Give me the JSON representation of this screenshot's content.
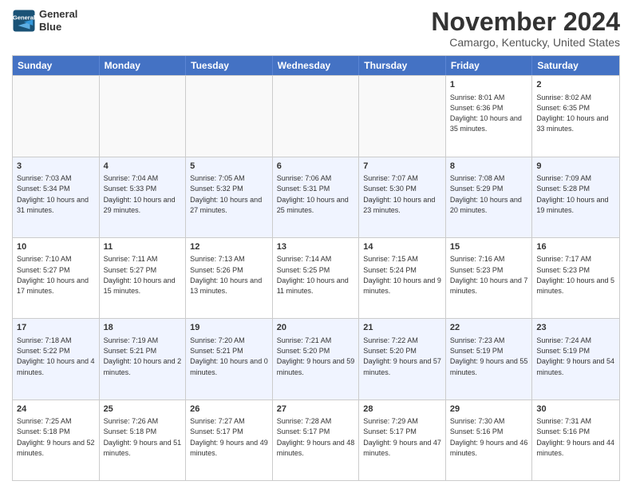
{
  "logo": {
    "line1": "General",
    "line2": "Blue"
  },
  "title": "November 2024",
  "location": "Camargo, Kentucky, United States",
  "days_of_week": [
    "Sunday",
    "Monday",
    "Tuesday",
    "Wednesday",
    "Thursday",
    "Friday",
    "Saturday"
  ],
  "weeks": [
    [
      {
        "day": "",
        "sunrise": "",
        "sunset": "",
        "daylight": "",
        "empty": true
      },
      {
        "day": "",
        "sunrise": "",
        "sunset": "",
        "daylight": "",
        "empty": true
      },
      {
        "day": "",
        "sunrise": "",
        "sunset": "",
        "daylight": "",
        "empty": true
      },
      {
        "day": "",
        "sunrise": "",
        "sunset": "",
        "daylight": "",
        "empty": true
      },
      {
        "day": "",
        "sunrise": "",
        "sunset": "",
        "daylight": "",
        "empty": true
      },
      {
        "day": "1",
        "sunrise": "Sunrise: 8:01 AM",
        "sunset": "Sunset: 6:36 PM",
        "daylight": "Daylight: 10 hours and 35 minutes.",
        "empty": false
      },
      {
        "day": "2",
        "sunrise": "Sunrise: 8:02 AM",
        "sunset": "Sunset: 6:35 PM",
        "daylight": "Daylight: 10 hours and 33 minutes.",
        "empty": false
      }
    ],
    [
      {
        "day": "3",
        "sunrise": "Sunrise: 7:03 AM",
        "sunset": "Sunset: 5:34 PM",
        "daylight": "Daylight: 10 hours and 31 minutes.",
        "empty": false
      },
      {
        "day": "4",
        "sunrise": "Sunrise: 7:04 AM",
        "sunset": "Sunset: 5:33 PM",
        "daylight": "Daylight: 10 hours and 29 minutes.",
        "empty": false
      },
      {
        "day": "5",
        "sunrise": "Sunrise: 7:05 AM",
        "sunset": "Sunset: 5:32 PM",
        "daylight": "Daylight: 10 hours and 27 minutes.",
        "empty": false
      },
      {
        "day": "6",
        "sunrise": "Sunrise: 7:06 AM",
        "sunset": "Sunset: 5:31 PM",
        "daylight": "Daylight: 10 hours and 25 minutes.",
        "empty": false
      },
      {
        "day": "7",
        "sunrise": "Sunrise: 7:07 AM",
        "sunset": "Sunset: 5:30 PM",
        "daylight": "Daylight: 10 hours and 23 minutes.",
        "empty": false
      },
      {
        "day": "8",
        "sunrise": "Sunrise: 7:08 AM",
        "sunset": "Sunset: 5:29 PM",
        "daylight": "Daylight: 10 hours and 20 minutes.",
        "empty": false
      },
      {
        "day": "9",
        "sunrise": "Sunrise: 7:09 AM",
        "sunset": "Sunset: 5:28 PM",
        "daylight": "Daylight: 10 hours and 19 minutes.",
        "empty": false
      }
    ],
    [
      {
        "day": "10",
        "sunrise": "Sunrise: 7:10 AM",
        "sunset": "Sunset: 5:27 PM",
        "daylight": "Daylight: 10 hours and 17 minutes.",
        "empty": false
      },
      {
        "day": "11",
        "sunrise": "Sunrise: 7:11 AM",
        "sunset": "Sunset: 5:27 PM",
        "daylight": "Daylight: 10 hours and 15 minutes.",
        "empty": false
      },
      {
        "day": "12",
        "sunrise": "Sunrise: 7:13 AM",
        "sunset": "Sunset: 5:26 PM",
        "daylight": "Daylight: 10 hours and 13 minutes.",
        "empty": false
      },
      {
        "day": "13",
        "sunrise": "Sunrise: 7:14 AM",
        "sunset": "Sunset: 5:25 PM",
        "daylight": "Daylight: 10 hours and 11 minutes.",
        "empty": false
      },
      {
        "day": "14",
        "sunrise": "Sunrise: 7:15 AM",
        "sunset": "Sunset: 5:24 PM",
        "daylight": "Daylight: 10 hours and 9 minutes.",
        "empty": false
      },
      {
        "day": "15",
        "sunrise": "Sunrise: 7:16 AM",
        "sunset": "Sunset: 5:23 PM",
        "daylight": "Daylight: 10 hours and 7 minutes.",
        "empty": false
      },
      {
        "day": "16",
        "sunrise": "Sunrise: 7:17 AM",
        "sunset": "Sunset: 5:23 PM",
        "daylight": "Daylight: 10 hours and 5 minutes.",
        "empty": false
      }
    ],
    [
      {
        "day": "17",
        "sunrise": "Sunrise: 7:18 AM",
        "sunset": "Sunset: 5:22 PM",
        "daylight": "Daylight: 10 hours and 4 minutes.",
        "empty": false
      },
      {
        "day": "18",
        "sunrise": "Sunrise: 7:19 AM",
        "sunset": "Sunset: 5:21 PM",
        "daylight": "Daylight: 10 hours and 2 minutes.",
        "empty": false
      },
      {
        "day": "19",
        "sunrise": "Sunrise: 7:20 AM",
        "sunset": "Sunset: 5:21 PM",
        "daylight": "Daylight: 10 hours and 0 minutes.",
        "empty": false
      },
      {
        "day": "20",
        "sunrise": "Sunrise: 7:21 AM",
        "sunset": "Sunset: 5:20 PM",
        "daylight": "Daylight: 9 hours and 59 minutes.",
        "empty": false
      },
      {
        "day": "21",
        "sunrise": "Sunrise: 7:22 AM",
        "sunset": "Sunset: 5:20 PM",
        "daylight": "Daylight: 9 hours and 57 minutes.",
        "empty": false
      },
      {
        "day": "22",
        "sunrise": "Sunrise: 7:23 AM",
        "sunset": "Sunset: 5:19 PM",
        "daylight": "Daylight: 9 hours and 55 minutes.",
        "empty": false
      },
      {
        "day": "23",
        "sunrise": "Sunrise: 7:24 AM",
        "sunset": "Sunset: 5:19 PM",
        "daylight": "Daylight: 9 hours and 54 minutes.",
        "empty": false
      }
    ],
    [
      {
        "day": "24",
        "sunrise": "Sunrise: 7:25 AM",
        "sunset": "Sunset: 5:18 PM",
        "daylight": "Daylight: 9 hours and 52 minutes.",
        "empty": false
      },
      {
        "day": "25",
        "sunrise": "Sunrise: 7:26 AM",
        "sunset": "Sunset: 5:18 PM",
        "daylight": "Daylight: 9 hours and 51 minutes.",
        "empty": false
      },
      {
        "day": "26",
        "sunrise": "Sunrise: 7:27 AM",
        "sunset": "Sunset: 5:17 PM",
        "daylight": "Daylight: 9 hours and 49 minutes.",
        "empty": false
      },
      {
        "day": "27",
        "sunrise": "Sunrise: 7:28 AM",
        "sunset": "Sunset: 5:17 PM",
        "daylight": "Daylight: 9 hours and 48 minutes.",
        "empty": false
      },
      {
        "day": "28",
        "sunrise": "Sunrise: 7:29 AM",
        "sunset": "Sunset: 5:17 PM",
        "daylight": "Daylight: 9 hours and 47 minutes.",
        "empty": false
      },
      {
        "day": "29",
        "sunrise": "Sunrise: 7:30 AM",
        "sunset": "Sunset: 5:16 PM",
        "daylight": "Daylight: 9 hours and 46 minutes.",
        "empty": false
      },
      {
        "day": "30",
        "sunrise": "Sunrise: 7:31 AM",
        "sunset": "Sunset: 5:16 PM",
        "daylight": "Daylight: 9 hours and 44 minutes.",
        "empty": false
      }
    ]
  ]
}
